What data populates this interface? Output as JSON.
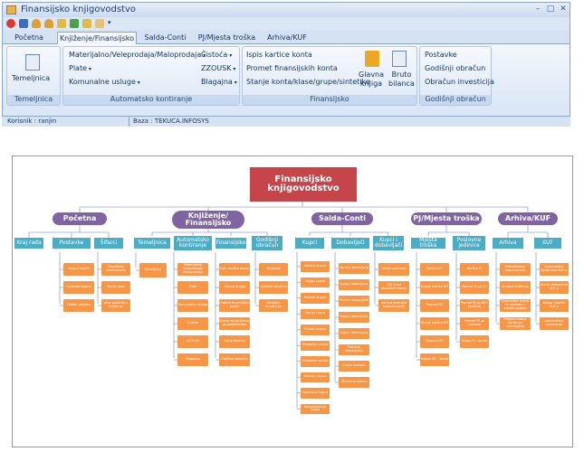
{
  "window": {
    "title": "Finansijsko knjigovodstvo"
  },
  "tabs": [
    "Početna",
    "Knjiženje/Finansijsko",
    "Salda-Conti",
    "PJ/Mjesta troška",
    "Arhiva/KUF"
  ],
  "ribbon": {
    "temeljnica": {
      "button": "Temeljnica",
      "group": "Temeljnica"
    },
    "automatsko": {
      "items": [
        "Materijalno/Veleprodaja/Maloprodaja",
        "Plate",
        "Komunalne usluge",
        "Čistoća",
        "ZZOUSK",
        "Blagajna"
      ],
      "group": "Automatsko kontiranje"
    },
    "finansijsko": {
      "items": [
        "Ispis kartice konta",
        "Promet finansijskih konta",
        "Stanje konta/klase/grupe/sintetike"
      ],
      "big": [
        "Glavna\nknjiga",
        "Bruto\nbilanca"
      ],
      "group": "Finansijsko"
    },
    "godisnji": {
      "items": [
        "Postavke",
        "Godišnji obračun",
        "Obračun investicija"
      ],
      "group": "Godišnji obračun"
    }
  },
  "status": {
    "user": "Korisnik : ranjin",
    "db": "Baza : TEKUCA.INFOSYS"
  },
  "chart": {
    "root": "Finansijsko\nknjigovodstvo",
    "level1": [
      "Početna",
      "Knjiženje/\nFinansijsko",
      "Salda-Conti",
      "PJ/Mjesta troška",
      "Arhiva/KUF"
    ],
    "level2": [
      "Kraj rada",
      "Postavke",
      "Šifarci",
      "Temeljnica",
      "Automatsko\nkontiranje",
      "Finansijsko",
      "Godišnji\nobračun",
      "Kupci",
      "Dobavljači",
      "Kupci i\ndobavljači",
      "Mjesta troška",
      "Poslovne\njedinice",
      "Arhiva",
      "KUF"
    ],
    "level3": {
      "postavke": [
        "Postavi logiku",
        "Postavke kopiraj",
        "Odabir objekta"
      ],
      "sifarci": [
        "Šifre/Naziv dokumenata",
        "Kontni plan",
        "Veza analitika s knjiženje"
      ],
      "temeljnica": [
        "Temeljnica"
      ],
      "automatsko": [
        "Materijalno/ Veleprodaja/ Maloprodaja",
        "Plate",
        "Komunalne usluge",
        "Čistoća",
        "ZZOUSK",
        "Blagajna"
      ],
      "finansijsko": [
        "Ispis kartice konta",
        "Glavna knjiga",
        "Promet finansijskih konta",
        "Stanje konta/klase/ grupe/sintetike",
        "Bruto bilanca",
        "Godišnji obračun"
      ],
      "godisnji": [
        "Postavke",
        "Godišnji obračun",
        "Obračun investicija"
      ],
      "kupci": [
        "Kartica kupca",
        "Knjiga kupca",
        "Promet kupca",
        "Stanje kupca",
        "Prijem izvoda",
        "Otvorene stavke",
        "Otvorene stavke",
        "Kamate kupca",
        "Opomene kupca",
        "Kompenzacija kupca"
      ],
      "dobavljaci": [
        "Kartica dobavljača",
        "Knjiga dobavljača",
        "Promet dobavljača",
        "Stanje dobavljača",
        "Odljev dobavljača",
        "Plaćanje dobavljača",
        "Stanje kamata",
        "Otvorene stavke"
      ],
      "kupciidob": [
        "Stanje partnera",
        "IOS izvod otvorenih stavki",
        "Kartica partnera kompenzacija"
      ],
      "mjesta": [
        "Kartica MT",
        "Knjiga kartice MT",
        "Promet MT",
        "Stanje kartice MT",
        "Bilanca MT",
        "Knjiga MT - konto"
      ],
      "poslovne": [
        "Kartica PJ",
        "Promet PJ po MT",
        "Promet PJ po MT i kontima",
        "Promet PJ po kontima",
        "Knjiga PJ - konto"
      ],
      "arhiva": [
        "Pretraživanje dokumenata",
        "Pregled knjiženja",
        "Usporedba stanja na prometu s ostalih godina",
        "Pregled stanja konta po razdobljima"
      ],
      "kuf": [
        "Automatsko kontiranje KUF-a",
        "Ulazni dokumenti KUF-a",
        "Knjiga ulaznih KUF-a",
        "Automatsko kontiranje"
      ]
    }
  }
}
